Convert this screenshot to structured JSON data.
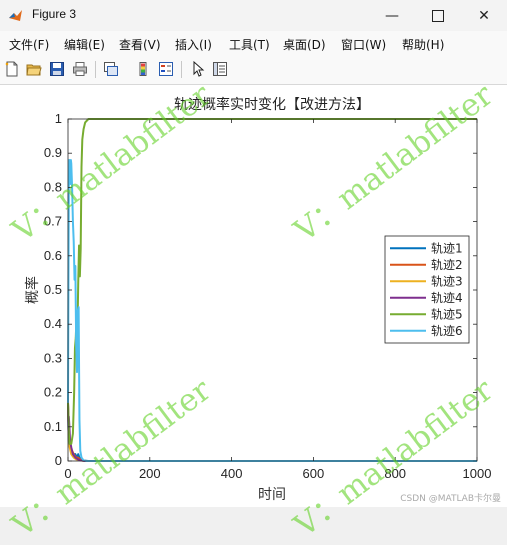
{
  "window": {
    "title": "Figure 3"
  },
  "menu": [
    "文件(F)",
    "编辑(E)",
    "查看(V)",
    "插入(I)",
    "工具(T)",
    "桌面(D)",
    "窗口(W)",
    "帮助(H)"
  ],
  "toolbar_icons": [
    "new-file-icon",
    "open-folder-icon",
    "save-icon",
    "print-icon",
    "link-plot-icon",
    "colorbar-icon",
    "legend-icon",
    "pointer-icon",
    "property-inspector-icon"
  ],
  "watermark_text": "V：matlabfilter",
  "credit": "CSDN @MATLAB卡尔曼",
  "chart_data": {
    "type": "line",
    "title": "轨迹概率实时变化【改进方法】",
    "xlabel": "时间",
    "ylabel": "概率",
    "xlim": [
      0,
      1000
    ],
    "ylim": [
      0,
      1
    ],
    "xticks": [
      0,
      200,
      400,
      600,
      800,
      1000
    ],
    "yticks": [
      0,
      0.1,
      0.2,
      0.3,
      0.4,
      0.5,
      0.6,
      0.7,
      0.8,
      0.9,
      1
    ],
    "legend_position": "right",
    "grid": false,
    "series": [
      {
        "name": "轨迹1",
        "color": "#0072BD",
        "points": [
          [
            0,
            0.17
          ],
          [
            1,
            0.1
          ],
          [
            2,
            0.06
          ],
          [
            3,
            0.05
          ],
          [
            5,
            0.04
          ],
          [
            8,
            0.03
          ],
          [
            12,
            0.02
          ],
          [
            18,
            0.02
          ],
          [
            22,
            0.01
          ],
          [
            25,
            0.02
          ],
          [
            28,
            0.01
          ],
          [
            30,
            0.005
          ],
          [
            33,
            0.003
          ],
          [
            40,
            0.001
          ],
          [
            50,
            0
          ],
          [
            1000,
            0
          ]
        ]
      },
      {
        "name": "轨迹2",
        "color": "#D95319",
        "points": [
          [
            0,
            0.17
          ],
          [
            1,
            0.12
          ],
          [
            2,
            0.08
          ],
          [
            4,
            0.05
          ],
          [
            7,
            0.03
          ],
          [
            10,
            0.03
          ],
          [
            14,
            0.02
          ],
          [
            20,
            0.01
          ],
          [
            25,
            0.01
          ],
          [
            30,
            0.004
          ],
          [
            35,
            0.002
          ],
          [
            45,
            0
          ],
          [
            1000,
            0
          ]
        ]
      },
      {
        "name": "轨迹3",
        "color": "#EDB120",
        "points": [
          [
            0,
            0.17
          ],
          [
            2,
            0.07
          ],
          [
            4,
            0.04
          ],
          [
            8,
            0.02
          ],
          [
            14,
            0.01
          ],
          [
            20,
            0.005
          ],
          [
            30,
            0.002
          ],
          [
            40,
            0
          ],
          [
            1000,
            0
          ]
        ]
      },
      {
        "name": "轨迹4",
        "color": "#7E2F8E",
        "points": [
          [
            0,
            0.17
          ],
          [
            1,
            0.09
          ],
          [
            2,
            0.13
          ],
          [
            3,
            0.11
          ],
          [
            5,
            0.06
          ],
          [
            8,
            0.04
          ],
          [
            12,
            0.02
          ],
          [
            18,
            0.01
          ],
          [
            24,
            0.005
          ],
          [
            30,
            0.002
          ],
          [
            40,
            0
          ],
          [
            1000,
            0
          ]
        ]
      },
      {
        "name": "轨迹5",
        "color": "#77AC30",
        "points": [
          [
            0,
            0.17
          ],
          [
            2,
            0.08
          ],
          [
            4,
            0.05
          ],
          [
            8,
            0.05
          ],
          [
            12,
            0.08
          ],
          [
            15,
            0.2
          ],
          [
            17,
            0.33
          ],
          [
            19,
            0.36
          ],
          [
            21,
            0.43
          ],
          [
            23,
            0.37
          ],
          [
            25,
            0.52
          ],
          [
            27,
            0.63
          ],
          [
            29,
            0.54
          ],
          [
            31,
            0.62
          ],
          [
            33,
            0.86
          ],
          [
            35,
            0.94
          ],
          [
            38,
            0.97
          ],
          [
            42,
            0.99
          ],
          [
            50,
            1.0
          ],
          [
            1000,
            1.0
          ]
        ]
      },
      {
        "name": "轨迹6",
        "color": "#4DBEEE",
        "points": [
          [
            0,
            0.17
          ],
          [
            1,
            0.5
          ],
          [
            2,
            0.82
          ],
          [
            3,
            0.88
          ],
          [
            4,
            0.86
          ],
          [
            5,
            0.86
          ],
          [
            6,
            0.81
          ],
          [
            7,
            0.88
          ],
          [
            8,
            0.87
          ],
          [
            10,
            0.8
          ],
          [
            12,
            0.7
          ],
          [
            14,
            0.64
          ],
          [
            16,
            0.53
          ],
          [
            18,
            0.57
          ],
          [
            20,
            0.34
          ],
          [
            22,
            0.26
          ],
          [
            24,
            0.44
          ],
          [
            26,
            0.45
          ],
          [
            28,
            0.12
          ],
          [
            30,
            0.03
          ],
          [
            33,
            0.01
          ],
          [
            38,
            0.002
          ],
          [
            45,
            0
          ],
          [
            1000,
            0
          ]
        ]
      }
    ]
  }
}
